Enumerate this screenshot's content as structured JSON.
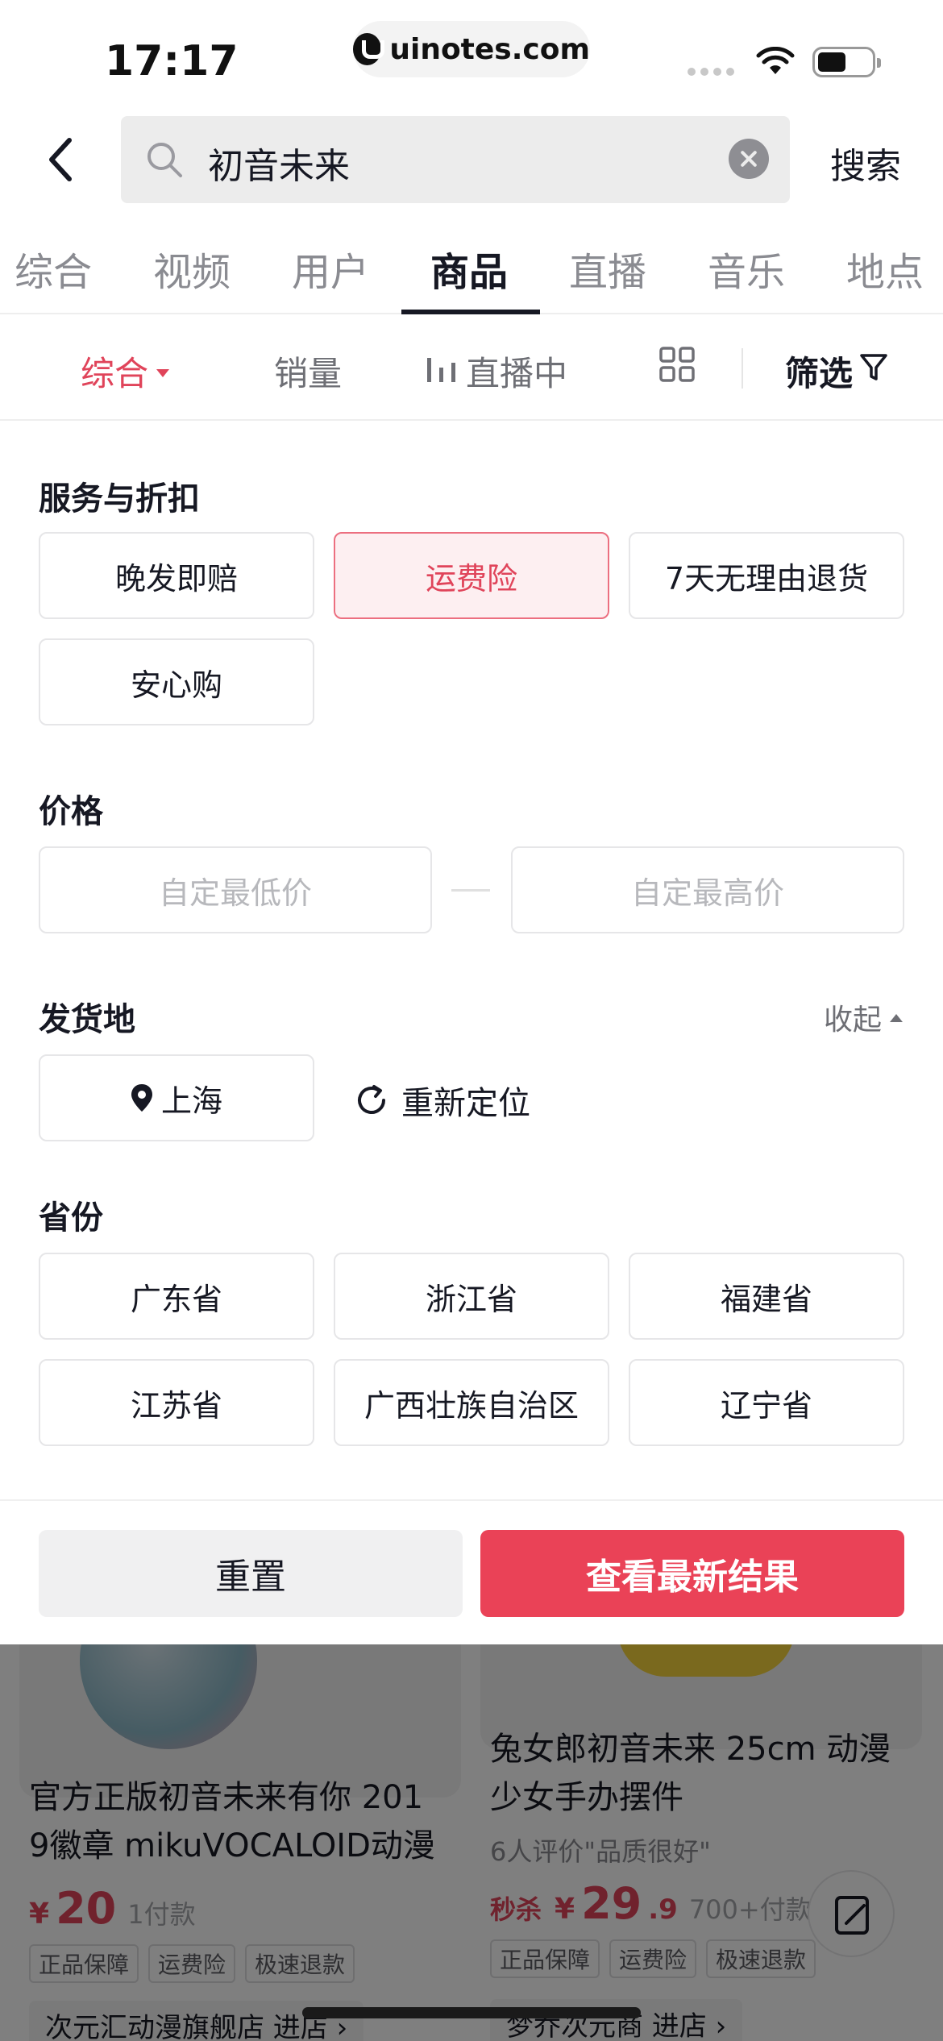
{
  "status_bar": {
    "time": "17:17",
    "url": "uinotes.com"
  },
  "search": {
    "query": "初音未来",
    "submit_label": "搜索"
  },
  "tabs": [
    {
      "label": "综合",
      "active": false
    },
    {
      "label": "视频",
      "active": false
    },
    {
      "label": "用户",
      "active": false
    },
    {
      "label": "商品",
      "active": true
    },
    {
      "label": "直播",
      "active": false
    },
    {
      "label": "音乐",
      "active": false
    },
    {
      "label": "地点",
      "active": false
    }
  ],
  "sort_bar": {
    "comprehensive": "综合",
    "sales": "销量",
    "live": "直播中",
    "filter": "筛选"
  },
  "filter_panel": {
    "services": {
      "title": "服务与折扣",
      "options": [
        {
          "label": "晚发即赔",
          "selected": false
        },
        {
          "label": "运费险",
          "selected": true
        },
        {
          "label": "7天无理由退货",
          "selected": false
        },
        {
          "label": "安心购",
          "selected": false
        }
      ]
    },
    "price": {
      "title": "价格",
      "min_placeholder": "自定最低价",
      "max_placeholder": "自定最高价"
    },
    "ship_from": {
      "title": "发货地",
      "collapse_label": "收起",
      "current_location": "上海",
      "relocate_label": "重新定位"
    },
    "province": {
      "title": "省份",
      "options": [
        "广东省",
        "浙江省",
        "福建省",
        "江苏省",
        "广西壮族自治区",
        "辽宁省"
      ]
    }
  },
  "actions": {
    "reset": "重置",
    "apply": "查看最新结果"
  },
  "results": [
    {
      "title_line1": "官方正版初音未来有你 201",
      "title_line2": "9徽章 mikuVOCALOID动漫",
      "price_symbol": "¥",
      "price": "20",
      "sold": "1付款",
      "badges": [
        "正品保障",
        "运费险",
        "极速退款"
      ],
      "shop": "次元汇动漫旗舰店  进店 ›"
    },
    {
      "title_line1": "兔女郎初音未来 25cm 动漫",
      "title_line2": "少女手办摆件",
      "reviews": "6人评价\"品质很好\"",
      "price_prefix": "秒杀",
      "price_symbol": "¥",
      "price": "29",
      "price_decimal": ".9",
      "sold": "700+付款",
      "badges": [
        "正品保障",
        "运费险",
        "极速退款"
      ],
      "shop": "梦乔次元商  进店 ›"
    }
  ],
  "colors": {
    "accent": "#ea4257",
    "selected_bg": "#fdeff1",
    "text": "#161823"
  }
}
